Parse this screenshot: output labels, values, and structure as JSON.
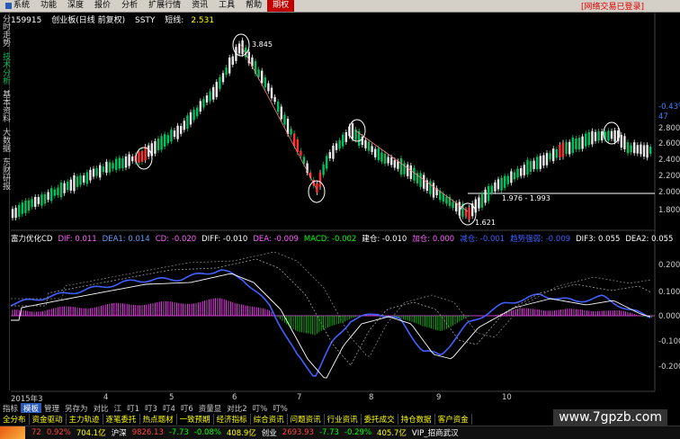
{
  "menu": {
    "items": [
      "系统",
      "功能",
      "深度",
      "报价",
      "分析",
      "扩展行情",
      "资讯",
      "工具",
      "帮助"
    ],
    "active": "期权",
    "right_text": "[网络交易已登录]"
  },
  "left_tabs": [
    "分时走势",
    "技术分析",
    "基本资料",
    "大数据",
    "东财研报"
  ],
  "header": {
    "code": "159915",
    "name": "创业板(日线 前复权)",
    "indicator": "SSTY",
    "short_label": "短线:",
    "short_value": "2.531"
  },
  "price_annotations": {
    "high": "3.845",
    "low": "1.621",
    "range": "1.976 - 1.993"
  },
  "indicator_row": [
    {
      "label": "富力优化CD",
      "color": "#ffffff"
    },
    {
      "label": "DIF: 0.011",
      "color": "#ff60ff"
    },
    {
      "label": "DEA1: 0.014",
      "color": "#60a0ff"
    },
    {
      "label": "CD: -0.020",
      "color": "#ff60ff"
    },
    {
      "label": "DIFF: -0.010",
      "color": "#ffffff"
    },
    {
      "label": "DEA: -0.009",
      "color": "#ff60ff"
    },
    {
      "label": "MACD: -0.002",
      "color": "#00ff00"
    },
    {
      "label": "建仓: -0.010",
      "color": "#ffffff"
    },
    {
      "label": "加仓: 0.000",
      "color": "#ff60ff"
    },
    {
      "label": "减仓: -0.001",
      "color": "#4060ff"
    },
    {
      "label": "趋势强弱: -0.009",
      "color": "#4060ff"
    },
    {
      "label": "DIF3: 0.055",
      "color": "#ffffff"
    },
    {
      "label": "DEA2: 0.055",
      "color": "#ffffff"
    }
  ],
  "right_axis_top": {
    "pct1": "-0.43%",
    "pct2": "47",
    "ticks": [
      "2.800",
      "2.600",
      "2.400",
      "2.200",
      "2.000",
      "1.800"
    ]
  },
  "right_axis_bottom": [
    "0.200",
    "0.100",
    "0.000",
    "-0.100",
    "-0.200"
  ],
  "x_axis": [
    "2015年3",
    "4",
    "5",
    "6",
    "7",
    "8",
    "9",
    "10"
  ],
  "bottom_tabs": [
    "指标",
    "模板",
    "管理",
    "另存为",
    "对比",
    "江",
    "叮1",
    "叮3",
    "叮4",
    "叮6",
    "资量显",
    "对比2",
    "叮%",
    "叮%"
  ],
  "bottom_tabs_selected": "模板",
  "bottom_strip": [
    "全分布",
    "资金驱动",
    "主力轨迹",
    "逐笔委托",
    "热点题材",
    "一致预期",
    "经济指标",
    "综合资讯",
    "问题资讯",
    "行业资讯",
    "委托成交",
    "持仓数据",
    "客户资金"
  ],
  "status_bar": [
    {
      "text": "72",
      "color": "#ff4040"
    },
    {
      "text": "0.92%",
      "color": "#ff4040"
    },
    {
      "text": "704.1亿",
      "color": "#ffff00"
    },
    {
      "text": "沪深",
      "color": "#ffffff"
    },
    {
      "text": "9826.13",
      "color": "#ff4040"
    },
    {
      "text": "-7.73",
      "color": "#00ff00"
    },
    {
      "text": "-0.08%",
      "color": "#00ff00"
    },
    {
      "text": "408.9亿",
      "color": "#ffff00"
    },
    {
      "text": "创业",
      "color": "#ffffff"
    },
    {
      "text": "2693.93",
      "color": "#ff4040"
    },
    {
      "text": "-7.73",
      "color": "#00ff00"
    },
    {
      "text": "-0.29%",
      "color": "#00ff00"
    },
    {
      "text": "405.7亿",
      "color": "#ffff00"
    },
    {
      "text": "VIP_招商武汉",
      "color": "#ffffff"
    }
  ],
  "watermark": "www.7gpzb.com",
  "colors": {
    "up": "#ff3030",
    "down": "#00c0c0",
    "ma": "#ffffff",
    "dif": "#4060ff",
    "dea": "#ffffff",
    "bar_pos": "#ff40ff",
    "bar_neg": "#00c000"
  }
}
